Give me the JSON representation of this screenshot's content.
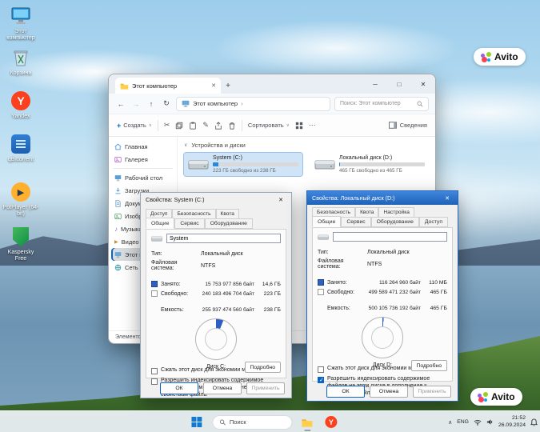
{
  "icons": {
    "close": "✕",
    "minimize": "─",
    "maximize": "□",
    "plus": "+",
    "back": "←",
    "forward": "→",
    "up": "↑",
    "refresh": "↻",
    "chevron_down": "∨",
    "chevron_right": "›",
    "chevron_up": "∧",
    "more": "⋯",
    "cut": "✂",
    "rename": "✎",
    "music": "♪",
    "play": "▶"
  },
  "desktop": {
    "icons": [
      {
        "label": "Этот компьютер"
      },
      {
        "label": "Корзина"
      },
      {
        "label": "Yandex"
      },
      {
        "label": "qBittorrent"
      },
      {
        "label": "PotPlayer (64-bit)"
      },
      {
        "label": "Kaspersky Free"
      }
    ]
  },
  "watermark": {
    "text": "Avito"
  },
  "explorer": {
    "tab": "Этот компьютер",
    "address": "Этот компьютер",
    "search": "Поиск: Этот компьютер",
    "toolbar": {
      "new": "Создать",
      "sort": "Сортировать",
      "details": "Сведения"
    },
    "section": "Устройства и диски",
    "sidebar": [
      {
        "label": "Главная"
      },
      {
        "label": "Галерея"
      },
      {
        "label": "Рабочий стол"
      },
      {
        "label": "Загрузки"
      },
      {
        "label": "Документы"
      },
      {
        "label": "Изображения"
      },
      {
        "label": "Музыка"
      },
      {
        "label": "Видео"
      },
      {
        "label": "Этот компьютер"
      },
      {
        "label": "Сеть"
      }
    ],
    "drives": [
      {
        "name": "System (C:)",
        "free": "223 ГБ свободно из 238 ГБ",
        "used_pct": 6.3
      },
      {
        "name": "Локальный диск (D:)",
        "free": "465 ГБ свободно из 465 ГБ",
        "used_pct": 0.6
      }
    ],
    "status": "Элементов: 5"
  },
  "dialog_c": {
    "title": "Свойства: System (C:)",
    "tabs_back": [
      "Доступ",
      "Безопасность",
      "Квота"
    ],
    "tabs_front": [
      "Общие",
      "Сервис",
      "Оборудование"
    ],
    "name": "System",
    "type_label": "Тип:",
    "type": "Локальный диск",
    "fs_label": "Файловая система:",
    "fs": "NTFS",
    "used_label": "Занято:",
    "used_bytes": "15 753 977 856 байт",
    "used_hr": "14,6 ГБ",
    "free_label": "Свободно:",
    "free_bytes": "240 183 496 704 байт",
    "free_hr": "223 ГБ",
    "cap_label": "Емкость:",
    "cap_bytes": "255 937 474 560 байт",
    "cap_hr": "238 ГБ",
    "disk": "Диск C:",
    "details": "Подробно",
    "cb1": "Сжать этот диск для экономии места",
    "cb2": "Разрешить индексировать содержимое файлов на этом диске в дополнение к свойствам файла",
    "cb1_checked": false,
    "cb2_checked": false,
    "ok": "ОК",
    "cancel": "Отмена",
    "apply": "Применить",
    "pie_pct": 6
  },
  "dialog_d": {
    "title": "Свойства: Локальный диск (D:)",
    "tabs_back": [
      "Безопасность",
      "Квота",
      "Настройка"
    ],
    "tabs_front": [
      "Общие",
      "Сервис",
      "Оборудование",
      "Доступ"
    ],
    "name": "",
    "type_label": "Тип:",
    "type": "Локальный диск",
    "fs_label": "Файловая система:",
    "fs": "NTFS",
    "used_label": "Занято:",
    "used_bytes": "116 264 960 байт",
    "used_hr": "110 МБ",
    "free_label": "Свободно:",
    "free_bytes": "499 589 471 232 байт",
    "free_hr": "465 ГБ",
    "cap_label": "Емкость:",
    "cap_bytes": "500 105 736 192 байт",
    "cap_hr": "465 ГБ",
    "disk": "Диск D:",
    "details": "Подробно",
    "cb1": "Сжать этот диск для экономии места",
    "cb2": "Разрешить индексировать содержимое файлов на этом диске в дополнение к свойствам файла",
    "cb1_checked": false,
    "cb2_checked": true,
    "ok": "ОК",
    "cancel": "Отмена",
    "apply": "Применить",
    "pie_pct": 1
  },
  "taskbar": {
    "search": "Поиск",
    "lang": "ENG",
    "time": "21:52",
    "date": "26.09.2024"
  }
}
